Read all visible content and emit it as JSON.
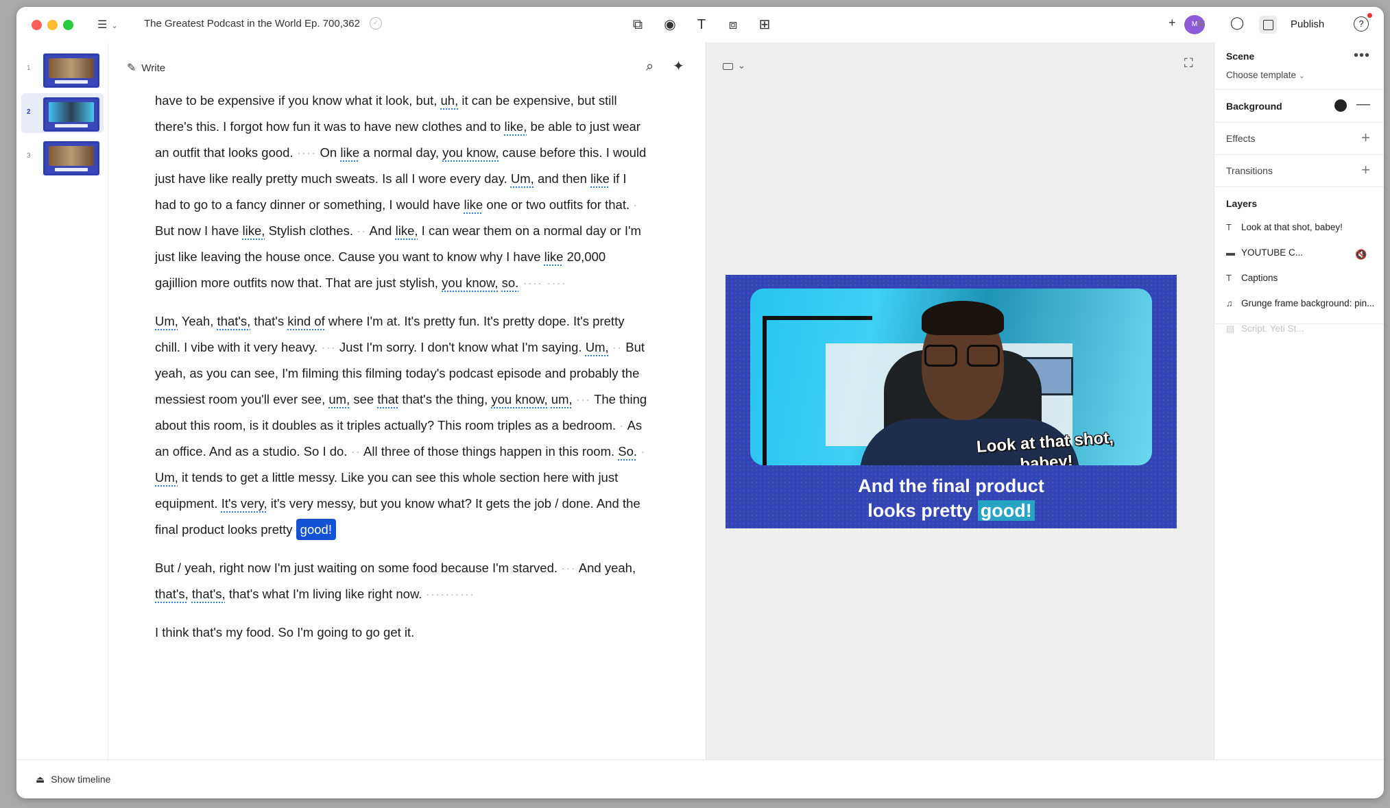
{
  "titlebar": {
    "doc_title": "The Greatest Podcast in the World Ep. 700,362",
    "publish_label": "Publish",
    "avatar_initials": "M"
  },
  "scenes": [
    {
      "number": "1"
    },
    {
      "number": "2"
    },
    {
      "number": "3"
    }
  ],
  "editor": {
    "write_label": "Write",
    "paragraphs": [
      [
        {
          "t": "have to be expensive if you know what it look, but, "
        },
        {
          "t": "uh,",
          "f": true
        },
        {
          "t": " it can be expensive, but still there's this. I forgot how fun it was to have new clothes and to "
        },
        {
          "t": "like,",
          "f": true
        },
        {
          "t": " be able to just wear an outfit that looks good. "
        },
        {
          "t": "····",
          "p": true
        },
        {
          "t": " On "
        },
        {
          "t": "like",
          "f": true
        },
        {
          "t": " a normal day, "
        },
        {
          "t": "you know,",
          "f": true
        },
        {
          "t": " cause before this. I would just have like really pretty much sweats. Is all I wore every day. "
        },
        {
          "t": "Um,",
          "f": true
        },
        {
          "t": " and then "
        },
        {
          "t": "like",
          "f": true
        },
        {
          "t": " if I had to go to a fancy dinner or something, I would have "
        },
        {
          "t": "like",
          "f": true
        },
        {
          "t": " one or two outfits for that. "
        },
        {
          "t": "·",
          "p": true
        },
        {
          "t": " But now I have "
        },
        {
          "t": "like,",
          "f": true
        },
        {
          "t": " Stylish clothes. "
        },
        {
          "t": "··",
          "p": true
        },
        {
          "t": " And "
        },
        {
          "t": "like,",
          "f": true
        },
        {
          "t": " I can wear them on a normal day or I'm just like leaving the house once. Cause you want to know why I have "
        },
        {
          "t": "like",
          "f": true
        },
        {
          "t": " 20,000 gajillion more outfits now that. That are just stylish, "
        },
        {
          "t": "you know,",
          "f": true
        },
        {
          "t": " "
        },
        {
          "t": "so.",
          "f": true
        },
        {
          "t": " ···· ····",
          "p": true
        }
      ],
      [
        {
          "t": "Um,",
          "f": true
        },
        {
          "t": " Yeah, "
        },
        {
          "t": "that's,",
          "f": true
        },
        {
          "t": " that's "
        },
        {
          "t": "kind of",
          "f": true
        },
        {
          "t": " where I'm at. It's pretty fun. It's pretty dope. It's pretty chill. I vibe with it very heavy. "
        },
        {
          "t": "···",
          "p": true
        },
        {
          "t": " Just I'm sorry. I don't know what I'm saying. "
        },
        {
          "t": "Um,",
          "f": true
        },
        {
          "t": " "
        },
        {
          "t": "··",
          "p": true
        },
        {
          "t": " But yeah, as you can see, I'm filming this filming today's podcast episode and probably the messiest room you'll ever see, "
        },
        {
          "t": "um,",
          "f": true
        },
        {
          "t": " see "
        },
        {
          "t": "that",
          "f": true
        },
        {
          "t": " that's the thing, "
        },
        {
          "t": "you know,",
          "f": true
        },
        {
          "t": " "
        },
        {
          "t": "um,",
          "f": true
        },
        {
          "t": " "
        },
        {
          "t": "···",
          "p": true
        },
        {
          "t": " The thing about this room, is it doubles as it triples actually? This room triples as a bedroom. "
        },
        {
          "t": "·",
          "p": true
        },
        {
          "t": " As an office. And as a studio. So I do. "
        },
        {
          "t": "··",
          "p": true
        },
        {
          "t": " All three of those things happen in this room. "
        },
        {
          "t": "So.",
          "f": true
        },
        {
          "t": " "
        },
        {
          "t": "·",
          "p": true
        },
        {
          "t": " "
        },
        {
          "t": "Um,",
          "f": true
        },
        {
          "t": " it tends to get a little messy. Like you can see this whole section here with just equipment. "
        },
        {
          "t": "It's very,",
          "f": true
        },
        {
          "t": " it's very messy, but you know what? It gets the job / done. And the final product looks pretty "
        },
        {
          "t": "good!",
          "h": true
        }
      ],
      [
        {
          "t": "But / yeah, right now I'm just waiting on some food because I'm starved. "
        },
        {
          "t": "···",
          "p": true
        },
        {
          "t": " And yeah, "
        },
        {
          "t": "that's,",
          "f": true
        },
        {
          "t": " "
        },
        {
          "t": "that's,",
          "f": true
        },
        {
          "t": " that's what I'm living like right now. "
        },
        {
          "t": "··········",
          "p": true
        }
      ],
      [
        {
          "t": "I think that's my food. So I'm going to go get it."
        }
      ]
    ]
  },
  "preview": {
    "overlay_line1": "Look at that shot,",
    "overlay_line2": "babey!",
    "caption_line1": "And the final product",
    "caption_line2_pre": "looks pretty ",
    "caption_line2_active": "good!"
  },
  "inspector": {
    "scene_title": "Scene",
    "choose_template": "Choose template",
    "background_title": "Background",
    "effects_label": "Effects",
    "transitions_label": "Transitions",
    "layers_title": "Layers",
    "layers": [
      {
        "icon": "T",
        "name": "Look at that shot, babey!"
      },
      {
        "icon": "▬",
        "name": "YOUTUBE C..."
      },
      {
        "icon": "T",
        "name": "Captions"
      },
      {
        "icon": "♫",
        "name": "Grunge frame background: pin..."
      },
      {
        "icon": "▤",
        "name": "Script: Yeti St..."
      }
    ],
    "background_color": "#222222"
  },
  "bottom": {
    "show_timeline": "Show timeline"
  },
  "colors": {
    "accent": "#1553d6",
    "frame_blue": "#3344b4",
    "filler_underline": "#2f7fd8"
  }
}
